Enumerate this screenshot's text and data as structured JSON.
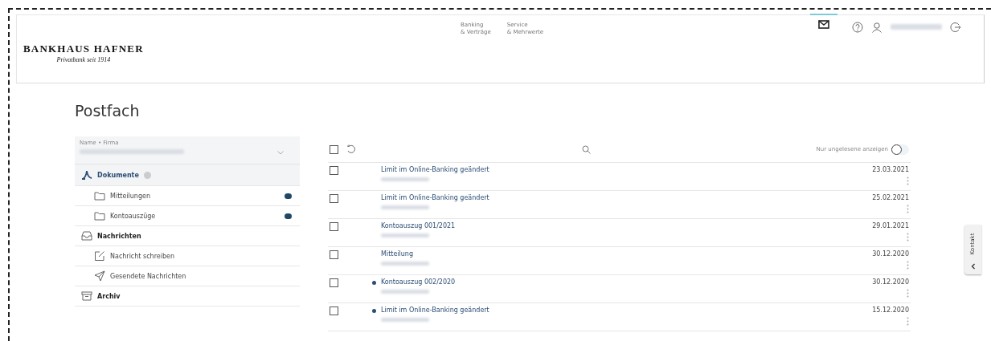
{
  "brand": {
    "name": "BANKHAUS HAFNER",
    "tagline": "Privatbank seit 1914"
  },
  "nav": [
    {
      "line1": "Banking",
      "line2": "& Verträge"
    },
    {
      "line1": "Service",
      "line2": "& Mehrwerte"
    }
  ],
  "header_tools": {
    "mail_selected": true
  },
  "page_title": "Postfach",
  "account_select": {
    "label": "Name • Firma"
  },
  "sidebar": [
    {
      "label": "Dokumente",
      "kind": "documents",
      "selected": true,
      "children": [
        {
          "label": "Mitteilungen",
          "kind": "folder",
          "selected": false
        },
        {
          "label": "Kontoauszüge",
          "kind": "folder",
          "selected": false
        }
      ]
    },
    {
      "label": "Nachrichten",
      "kind": "inbox",
      "selected": false,
      "children": [
        {
          "label": "Nachricht schreiben",
          "kind": "compose",
          "selected": false
        },
        {
          "label": "Gesendete Nachrichten",
          "kind": "sent",
          "selected": false
        }
      ]
    },
    {
      "label": "Archiv",
      "kind": "archive",
      "selected": false
    }
  ],
  "toolbar": {
    "select_all_checked": false,
    "toggle_label": "Nur ungelesene anzeigen",
    "toggle_on": false
  },
  "messages": [
    {
      "subject": "Limit im Online-Banking geändert",
      "date": "23.03.2021",
      "unread": false,
      "checked": false
    },
    {
      "subject": "Limit im Online-Banking geändert",
      "date": "25.02.2021",
      "unread": false,
      "checked": false
    },
    {
      "subject": "Kontoauszug 001/2021",
      "date": "29.01.2021",
      "unread": false,
      "checked": false
    },
    {
      "subject": "Mitteilung",
      "date": "30.12.2020",
      "unread": false,
      "checked": false
    },
    {
      "subject": "Kontoauszug 002/2020",
      "date": "30.12.2020",
      "unread": true,
      "checked": false
    },
    {
      "subject": "Limit im Online-Banking geändert",
      "date": "15.12.2020",
      "unread": true,
      "checked": false
    }
  ],
  "contact_tab": {
    "label": "Kontakt"
  }
}
